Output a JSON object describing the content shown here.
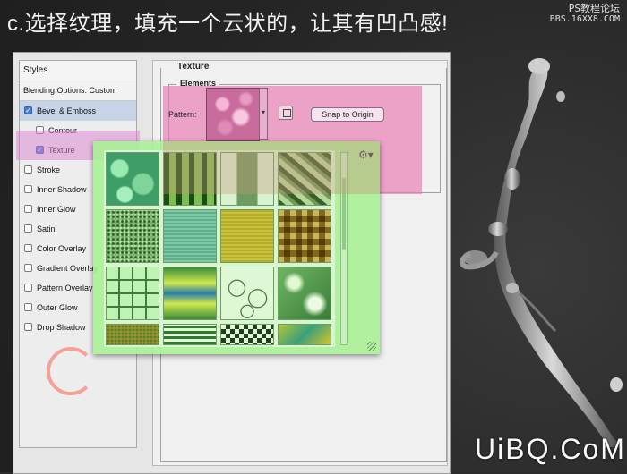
{
  "headline": "c.选择纹理，填充一个云状的，让其有凹凸感!",
  "watermark": {
    "line1": "PS教程论坛",
    "line2": "BBS.16XX8.COM"
  },
  "bottom_watermark": "UiBQ.CoM",
  "styles_panel": {
    "header": "Styles",
    "items": [
      {
        "label": "Blending Options: Custom",
        "checkbox": false,
        "checked": false,
        "indent": 0
      },
      {
        "label": "Bevel & Emboss",
        "checkbox": true,
        "checked": true,
        "indent": 0,
        "selected": true
      },
      {
        "label": "Contour",
        "checkbox": true,
        "checked": false,
        "indent": 1
      },
      {
        "label": "Texture",
        "checkbox": true,
        "checked": true,
        "indent": 1
      },
      {
        "label": "Stroke",
        "checkbox": true,
        "checked": false,
        "indent": 0
      },
      {
        "label": "Inner Shadow",
        "checkbox": true,
        "checked": false,
        "indent": 0
      },
      {
        "label": "Inner Glow",
        "checkbox": true,
        "checked": false,
        "indent": 0
      },
      {
        "label": "Satin",
        "checkbox": true,
        "checked": false,
        "indent": 0
      },
      {
        "label": "Color Overlay",
        "checkbox": true,
        "checked": false,
        "indent": 0
      },
      {
        "label": "Gradient Overlay",
        "checkbox": true,
        "checked": false,
        "indent": 0
      },
      {
        "label": "Pattern Overlay",
        "checkbox": true,
        "checked": false,
        "indent": 0
      },
      {
        "label": "Outer Glow",
        "checkbox": true,
        "checked": false,
        "indent": 0
      },
      {
        "label": "Drop Shadow",
        "checkbox": true,
        "checked": false,
        "indent": 0
      }
    ]
  },
  "annotation_letter": "C",
  "texture_panel": {
    "title": "Texture",
    "elements_title": "Elements",
    "pattern_label": "Pattern:",
    "snap_button": "Snap to Origin",
    "new_preset_icon": "new-preset-icon",
    "dropdown_icon": "chevron-down-icon"
  },
  "pattern_picker": {
    "gear_icon": "gear-icon",
    "patterns": [
      "bubbles-green",
      "woven-plaid",
      "stone-column",
      "wavy-stripes",
      "gravel-green",
      "fabric-green",
      "wood-yellow",
      "tile-squares",
      "grid-lines",
      "gradient-band",
      "marble-veins",
      "crumpled-satin",
      "moss-yellow",
      "concentric-squares",
      "checker",
      "abstract-ornament"
    ]
  },
  "colors": {
    "pink_highlight": "#e97eb2",
    "green_overlay": "#aaf096",
    "c_letter": "#f4a19a"
  }
}
